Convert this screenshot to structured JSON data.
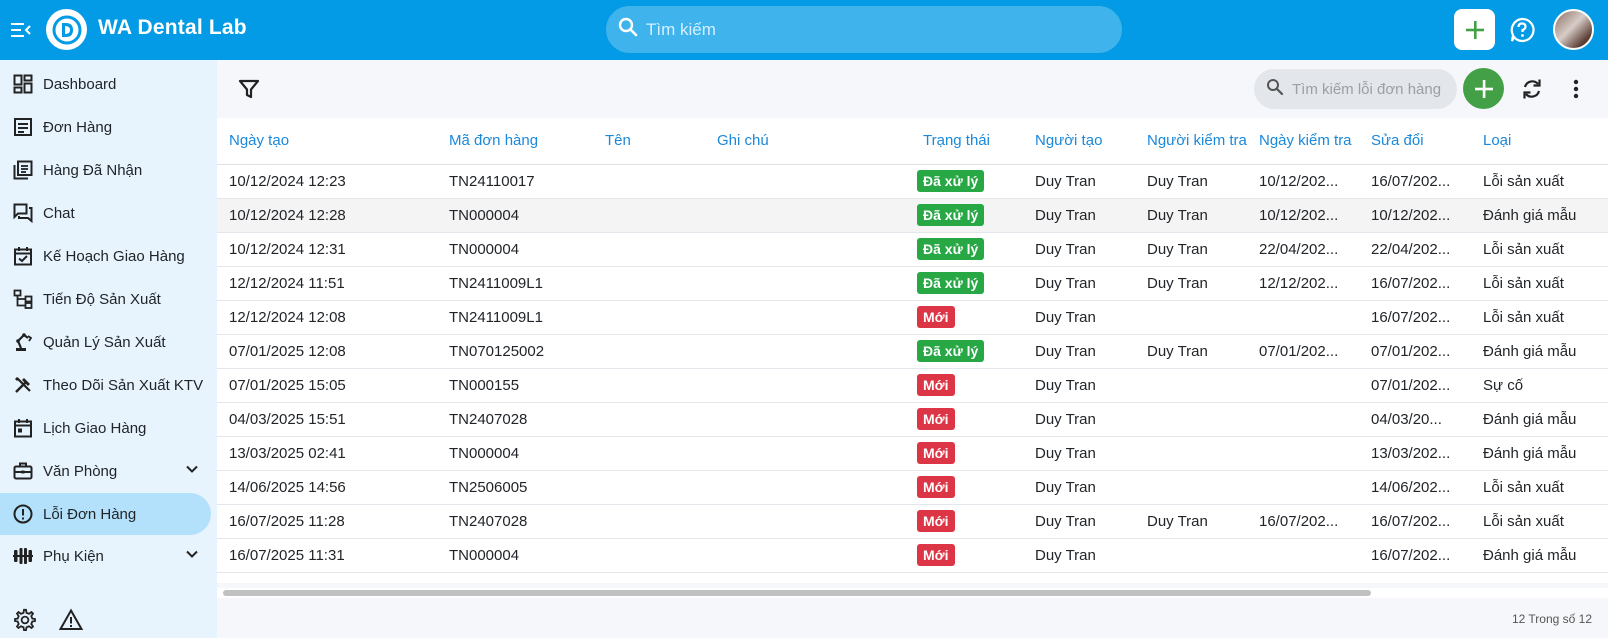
{
  "app": {
    "title": "WA Dental Lab"
  },
  "header": {
    "search_placeholder": "Tìm kiếm"
  },
  "sidebar": {
    "items": [
      {
        "label": "Dashboard",
        "icon": "dashboard-icon"
      },
      {
        "label": "Đơn Hàng",
        "icon": "document-icon"
      },
      {
        "label": "Hàng Đã Nhận",
        "icon": "received-list-icon"
      },
      {
        "label": "Chat",
        "icon": "chat-icon"
      },
      {
        "label": "Kế Hoạch Giao Hàng",
        "icon": "calendar-check-icon"
      },
      {
        "label": "Tiến Độ Sản Xuất",
        "icon": "hierarchy-icon"
      },
      {
        "label": "Quản Lý Sản Xuất",
        "icon": "robot-arm-icon"
      },
      {
        "label": "Theo Dõi Sản Xuất KTV",
        "icon": "tools-icon"
      },
      {
        "label": "Lịch Giao Hàng",
        "icon": "calendar-icon"
      },
      {
        "label": "Văn Phòng",
        "icon": "briefcase-icon",
        "expandable": true
      },
      {
        "label": "Lỗi Đơn Hàng",
        "icon": "alert-circle-icon",
        "active": true
      },
      {
        "label": "Phụ Kiện",
        "icon": "accessories-icon",
        "expandable": true
      }
    ]
  },
  "toolbar": {
    "search_placeholder": "Tìm kiếm lỗi đơn hàng"
  },
  "table": {
    "columns": [
      "Ngày tạo",
      "Mã đơn hàng",
      "Tên",
      "Ghi chú",
      "Trạng thái",
      "Người tạo",
      "Người kiểm tra",
      "Ngày kiểm tra",
      "Sửa đổi",
      "Loại"
    ],
    "rows": [
      {
        "created": "10/12/2024 12:23",
        "code": "TN24110017",
        "name": "",
        "note": "",
        "status": "Đã xử lý",
        "status_type": "done",
        "creator": "Duy Tran",
        "checker": "Duy Tran",
        "check_date": "10/12/202...",
        "modified": "16/07/202...",
        "type": "Lỗi sản xuất"
      },
      {
        "created": "10/12/2024 12:28",
        "code": "TN000004",
        "name": "",
        "note": "",
        "status": "Đã xử lý",
        "status_type": "done",
        "creator": "Duy Tran",
        "checker": "Duy Tran",
        "check_date": "10/12/202...",
        "modified": "10/12/202...",
        "type": "Đánh giá mẫu"
      },
      {
        "created": "10/12/2024 12:31",
        "code": "TN000004",
        "name": "",
        "note": "",
        "status": "Đã xử lý",
        "status_type": "done",
        "creator": "Duy Tran",
        "checker": "Duy Tran",
        "check_date": "22/04/202...",
        "modified": "22/04/202...",
        "type": "Lỗi sản xuất"
      },
      {
        "created": "12/12/2024 11:51",
        "code": "TN2411009L1",
        "name": "",
        "note": "",
        "status": "Đã xử lý",
        "status_type": "done",
        "creator": "Duy Tran",
        "checker": "Duy Tran",
        "check_date": "12/12/202...",
        "modified": "16/07/202...",
        "type": "Lỗi sản xuất"
      },
      {
        "created": "12/12/2024 12:08",
        "code": "TN2411009L1",
        "name": "",
        "note": "",
        "status": "Mới",
        "status_type": "new",
        "creator": "Duy Tran",
        "checker": "",
        "check_date": "",
        "modified": "16/07/202...",
        "type": "Lỗi sản xuất"
      },
      {
        "created": "07/01/2025 12:08",
        "code": "TN070125002",
        "name": "",
        "note": "",
        "status": "Đã xử lý",
        "status_type": "done",
        "creator": "Duy Tran",
        "checker": "Duy Tran",
        "check_date": "07/01/202...",
        "modified": "07/01/202...",
        "type": "Đánh giá mẫu"
      },
      {
        "created": "07/01/2025 15:05",
        "code": "TN000155",
        "name": "",
        "note": "",
        "status": "Mới",
        "status_type": "new",
        "creator": "Duy Tran",
        "checker": "",
        "check_date": "",
        "modified": "07/01/202...",
        "type": "Sự cố"
      },
      {
        "created": "04/03/2025 15:51",
        "code": "TN2407028",
        "name": "",
        "note": "",
        "status": "Mới",
        "status_type": "new",
        "creator": "Duy Tran",
        "checker": "",
        "check_date": "",
        "modified": "04/03/20...",
        "type": "Đánh giá mẫu"
      },
      {
        "created": "13/03/2025 02:41",
        "code": "TN000004",
        "name": "",
        "note": "",
        "status": "Mới",
        "status_type": "new",
        "creator": "Duy Tran",
        "checker": "",
        "check_date": "",
        "modified": "13/03/202...",
        "type": "Đánh giá mẫu"
      },
      {
        "created": "14/06/2025 14:56",
        "code": "TN2506005",
        "name": "",
        "note": "",
        "status": "Mới",
        "status_type": "new",
        "creator": "Duy Tran",
        "checker": "",
        "check_date": "",
        "modified": "14/06/202...",
        "type": "Lỗi sản xuất"
      },
      {
        "created": "16/07/2025 11:28",
        "code": "TN2407028",
        "name": "",
        "note": "",
        "status": "Mới",
        "status_type": "new",
        "creator": "Duy Tran",
        "checker": "Duy Tran",
        "check_date": "16/07/202...",
        "modified": "16/07/202...",
        "type": "Lỗi sản xuất"
      },
      {
        "created": "16/07/2025 11:31",
        "code": "TN000004",
        "name": "",
        "note": "",
        "status": "Mới",
        "status_type": "new",
        "creator": "Duy Tran",
        "checker": "",
        "check_date": "",
        "modified": "16/07/202...",
        "type": "Đánh giá mẫu"
      }
    ]
  },
  "footer": {
    "paging": "12 Trong số 12"
  },
  "colors": {
    "primary": "#039be5",
    "link": "#1a88db",
    "success": "#28a745",
    "danger": "#dc3545",
    "fab": "#43a047",
    "sidebar_bg": "#e8f4fd",
    "active_bg": "#b3e0fb"
  }
}
